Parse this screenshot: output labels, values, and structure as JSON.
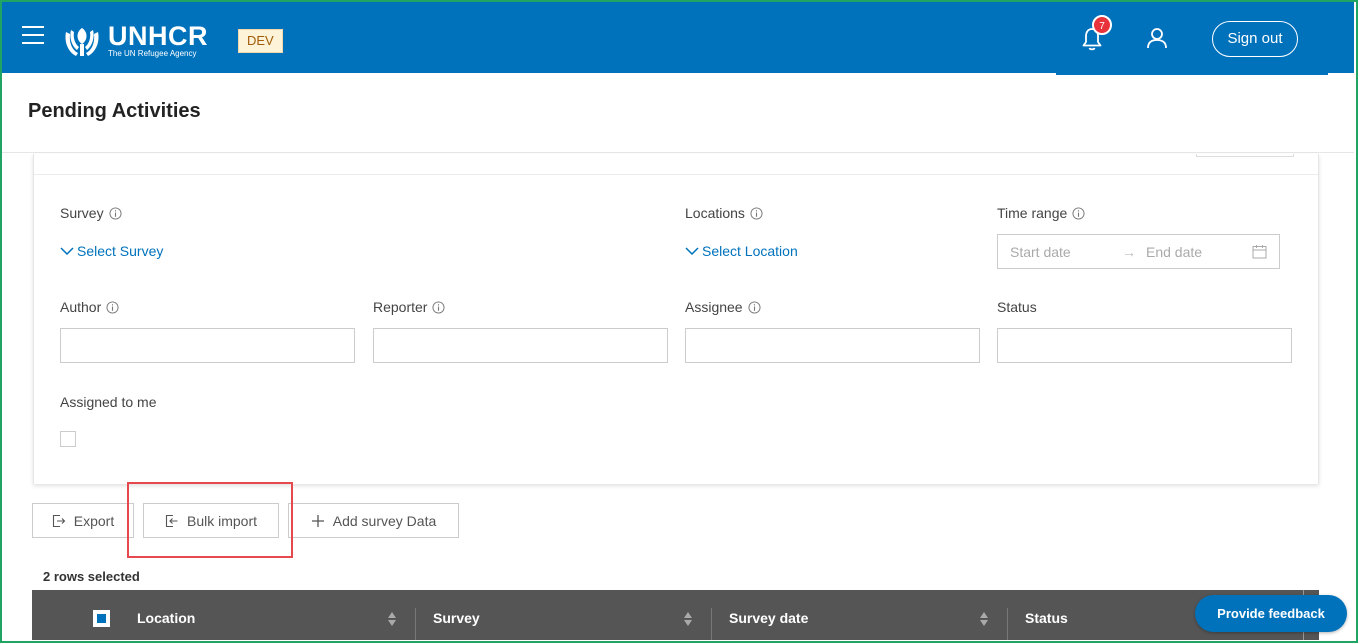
{
  "header": {
    "logo_title": "UNHCR",
    "logo_subtitle": "The UN Refugee Agency",
    "env_badge": "DEV",
    "notification_count": "7",
    "sign_out_label": "Sign out",
    "brand_color": "#0072bc"
  },
  "page": {
    "title": "Pending Activities"
  },
  "filters": {
    "survey_label": "Survey",
    "survey_select": "Select Survey",
    "locations_label": "Locations",
    "locations_select": "Select Location",
    "time_range_label": "Time range",
    "start_date_placeholder": "Start date",
    "end_date_placeholder": "End date",
    "author_label": "Author",
    "reporter_label": "Reporter",
    "assignee_label": "Assignee",
    "status_label": "Status",
    "assigned_to_me_label": "Assigned to me"
  },
  "actions": {
    "export_label": "Export",
    "bulk_import_label": "Bulk import",
    "add_survey_label": "Add survey Data"
  },
  "table": {
    "rows_selected": "2 rows selected",
    "columns": [
      "Location",
      "Survey",
      "Survey date",
      "Status"
    ]
  },
  "feedback_label": "Provide feedback"
}
